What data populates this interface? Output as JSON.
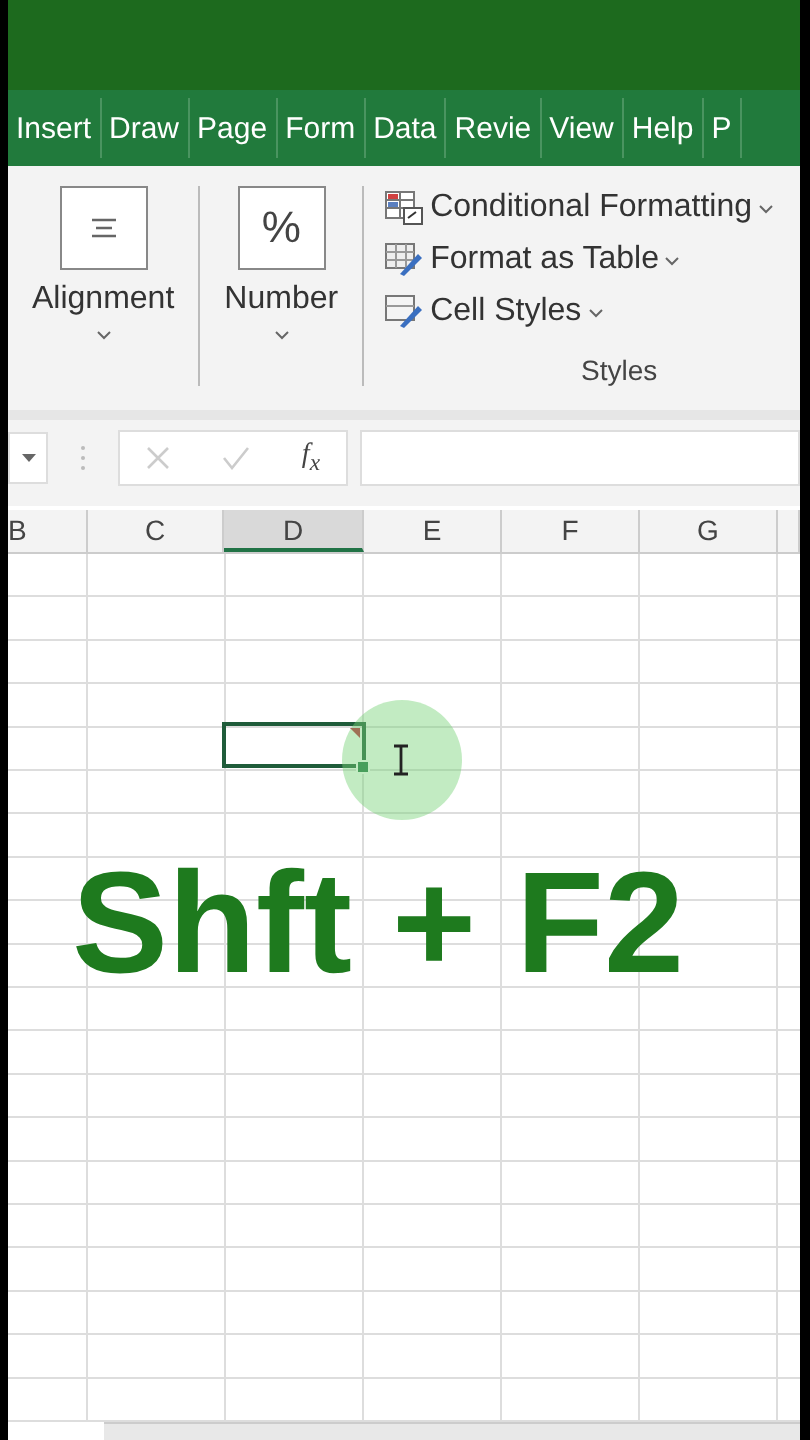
{
  "ribbon_tabs": [
    {
      "label": "Insert"
    },
    {
      "label": "Draw"
    },
    {
      "label": "Page"
    },
    {
      "label": "Form"
    },
    {
      "label": "Data"
    },
    {
      "label": "Revie"
    },
    {
      "label": "View"
    },
    {
      "label": "Help"
    },
    {
      "label": "P"
    }
  ],
  "ribbon": {
    "groups": [
      {
        "kind": "boxed",
        "label": "Alignment"
      },
      {
        "kind": "boxed",
        "label": "Number",
        "symbol": "%"
      }
    ],
    "styles": {
      "label": "Styles",
      "items": [
        {
          "kind": "conditional",
          "label": "Conditional Formatting"
        },
        {
          "kind": "table",
          "label": "Format as Table"
        },
        {
          "kind": "cell",
          "label": "Cell Styles"
        }
      ]
    }
  },
  "formula_bar": {
    "function_label": "f$_{x}$"
  },
  "sheet": {
    "columns": [
      {
        "label": "B",
        "selected": false
      },
      {
        "label": "C",
        "selected": false
      },
      {
        "label": "D",
        "selected": true
      },
      {
        "label": "E",
        "selected": false
      },
      {
        "label": "F",
        "selected": false
      },
      {
        "label": "G",
        "selected": false
      }
    ],
    "active_cell": {
      "note": true
    }
  },
  "caption": "Shft + F2"
}
